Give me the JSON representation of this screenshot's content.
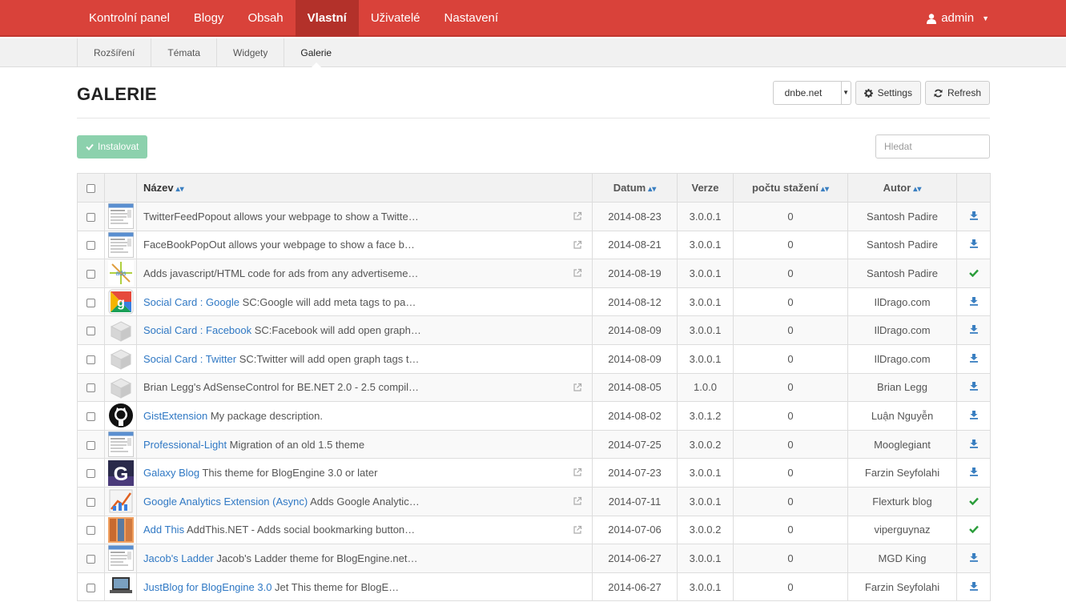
{
  "topnav": {
    "items": [
      {
        "label": "Kontrolní panel",
        "active": false
      },
      {
        "label": "Blogy",
        "active": false
      },
      {
        "label": "Obsah",
        "active": false
      },
      {
        "label": "Vlastní",
        "active": true
      },
      {
        "label": "Uživatelé",
        "active": false
      },
      {
        "label": "Nastavení",
        "active": false
      }
    ],
    "user": "admin"
  },
  "subnav": {
    "items": [
      {
        "label": "Rozšíření",
        "active": false
      },
      {
        "label": "Témata",
        "active": false
      },
      {
        "label": "Widgety",
        "active": false
      },
      {
        "label": "Galerie",
        "active": true
      }
    ]
  },
  "page": {
    "title": "GALERIE",
    "source_select": "dnbe.net",
    "settings_label": "Settings",
    "refresh_label": "Refresh",
    "install_label": "Instalovat",
    "search_placeholder": "Hledat"
  },
  "table": {
    "headers": {
      "name": "Název",
      "date": "Datum",
      "version": "Verze",
      "downloads": "počtu stažení",
      "author": "Autor"
    },
    "rows": [
      {
        "link": "",
        "desc": "TwitterFeedPopout allows your webpage to show a Twitte…",
        "ext": true,
        "date": "2014-08-23",
        "version": "3.0.0.1",
        "downloads": "0",
        "author": "Santosh Padire",
        "action": "download",
        "thumb": "screenshot"
      },
      {
        "link": "",
        "desc": "FaceBookPopOut allows your webpage to show a face b…",
        "ext": true,
        "date": "2014-08-21",
        "version": "3.0.0.1",
        "downloads": "0",
        "author": "Santosh Padire",
        "action": "download",
        "thumb": "screenshot"
      },
      {
        "link": "",
        "desc": "Adds javascript/HTML code for ads from any advertiseme…",
        "ext": true,
        "date": "2014-08-19",
        "version": "3.0.0.1",
        "downloads": "0",
        "author": "Santosh Padire",
        "action": "installed",
        "thumb": "adscript"
      },
      {
        "link": "Social Card : Google",
        "desc": " SC:Google will add meta tags to pa…",
        "ext": false,
        "date": "2014-08-12",
        "version": "3.0.0.1",
        "downloads": "0",
        "author": "IlDrago.com",
        "action": "download",
        "thumb": "google"
      },
      {
        "link": "Social Card : Facebook",
        "desc": " SC:Facebook will add open graph…",
        "ext": false,
        "date": "2014-08-09",
        "version": "3.0.0.1",
        "downloads": "0",
        "author": "IlDrago.com",
        "action": "download",
        "thumb": "box"
      },
      {
        "link": "Social Card : Twitter",
        "desc": " SC:Twitter will add open graph tags t…",
        "ext": false,
        "date": "2014-08-09",
        "version": "3.0.0.1",
        "downloads": "0",
        "author": "IlDrago.com",
        "action": "download",
        "thumb": "box"
      },
      {
        "link": "",
        "desc": "Brian Legg's AdSenseControl for BE.NET 2.0 - 2.5 compil…",
        "ext": true,
        "date": "2014-08-05",
        "version": "1.0.0",
        "downloads": "0",
        "author": "Brian Legg",
        "action": "download",
        "thumb": "box"
      },
      {
        "link": "GistExtension",
        "desc": " My package description.",
        "ext": false,
        "date": "2014-08-02",
        "version": "3.0.1.2",
        "downloads": "0",
        "author": "Luận Nguyễn",
        "action": "download",
        "thumb": "github"
      },
      {
        "link": "Professional-Light",
        "desc": " Migration of an old 1.5 theme",
        "ext": false,
        "date": "2014-07-25",
        "version": "3.0.0.2",
        "downloads": "0",
        "author": "Mooglegiant",
        "action": "download",
        "thumb": "screenshot"
      },
      {
        "link": "Galaxy Blog",
        "desc": " This theme for BlogEngine 3.0 or later",
        "ext": true,
        "date": "2014-07-23",
        "version": "3.0.0.1",
        "downloads": "0",
        "author": "Farzin Seyfolahi",
        "action": "download",
        "thumb": "galaxy"
      },
      {
        "link": "Google Analytics Extension (Async)",
        "desc": " Adds Google Analytic…",
        "ext": true,
        "date": "2014-07-11",
        "version": "3.0.0.1",
        "downloads": "0",
        "author": "Flexturk blog",
        "action": "installed",
        "thumb": "analytics"
      },
      {
        "link": "Add This",
        "desc": " AddThis.NET - Adds social bookmarking button…",
        "ext": true,
        "date": "2014-07-06",
        "version": "3.0.0.2",
        "downloads": "0",
        "author": "viperguynaz",
        "action": "installed",
        "thumb": "addthis"
      },
      {
        "link": "Jacob's Ladder",
        "desc": " Jacob's Ladder theme for BlogEngine.net…",
        "ext": false,
        "date": "2014-06-27",
        "version": "3.0.0.1",
        "downloads": "0",
        "author": "MGD King",
        "action": "download",
        "thumb": "screenshot"
      },
      {
        "link": "JustBlog for BlogEngine 3.0",
        "desc": " Jet This theme for BlogE…",
        "ext": false,
        "date": "2014-06-27",
        "version": "3.0.0.1",
        "downloads": "0",
        "author": "Farzin Seyfolahi",
        "action": "download",
        "thumb": "laptop"
      }
    ]
  },
  "colors": {
    "topbar": "#d9423a",
    "link": "#2f78c4",
    "install_button": "#8cd1ad",
    "download_icon": "#3a7fc1",
    "installed_check": "#2a9d3a"
  }
}
